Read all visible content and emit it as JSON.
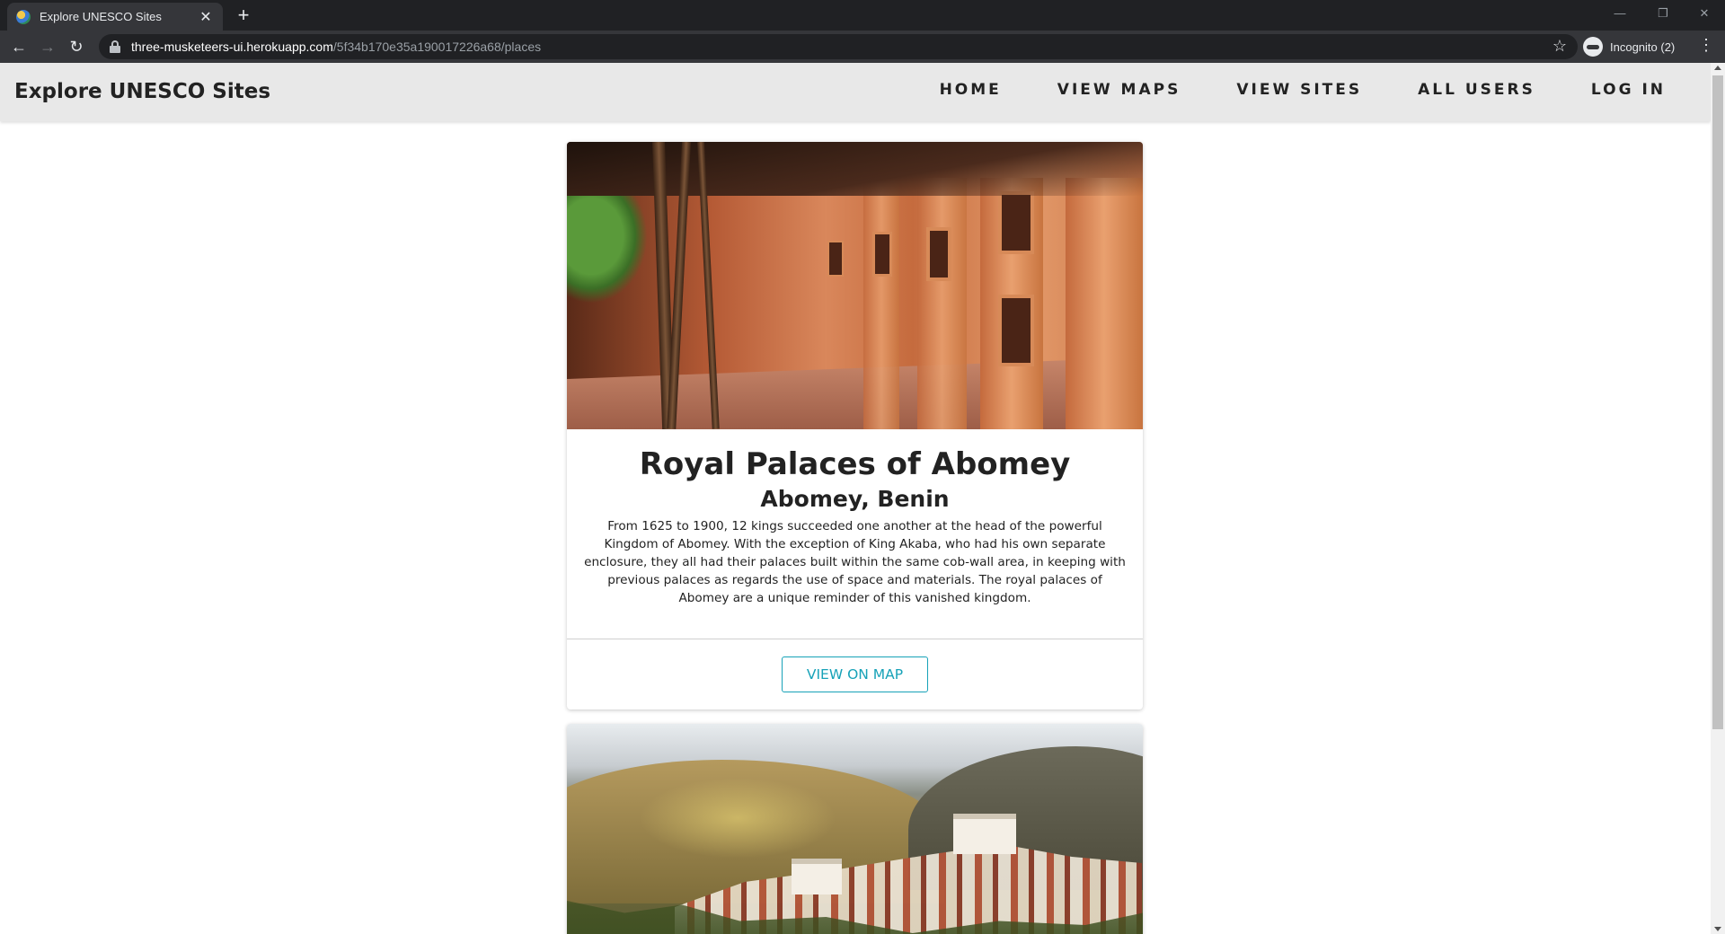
{
  "browser": {
    "tab_title": "Explore UNESCO Sites",
    "tab_close": "✕",
    "new_tab": "+",
    "url_host": "three-musketeers-ui.herokuapp.com",
    "url_path": "/5f34b170e35a190017226a68/places",
    "profile_label": "Incognito (2)",
    "icons": [
      "back-icon",
      "forward-icon",
      "reload-icon",
      "lock-icon",
      "star-icon",
      "incognito-icon",
      "menu-icon"
    ]
  },
  "header": {
    "title": "Explore UNESCO Sites",
    "nav": [
      "HOME",
      "VIEW MAPS",
      "VIEW SITES",
      "ALL USERS",
      "LOG IN"
    ]
  },
  "places": [
    {
      "name": "Royal Palaces of Abomey",
      "location": "Abomey, Benin",
      "description": "From 1625 to 1900, 12 kings succeeded one another at the head of the powerful Kingdom of Abomey. With the exception of King Akaba, who had his own separate enclosure, they all had their palaces built within the same cob-wall area, in keeping with previous palaces as regards the use of space and materials. The royal palaces of Abomey are a unique reminder of this vanished kingdom.",
      "button": "VIEW ON MAP"
    }
  ],
  "colors": {
    "accent": "#17a2b8",
    "header_bg": "#e8e8e8",
    "chrome_dark": "#202124"
  }
}
